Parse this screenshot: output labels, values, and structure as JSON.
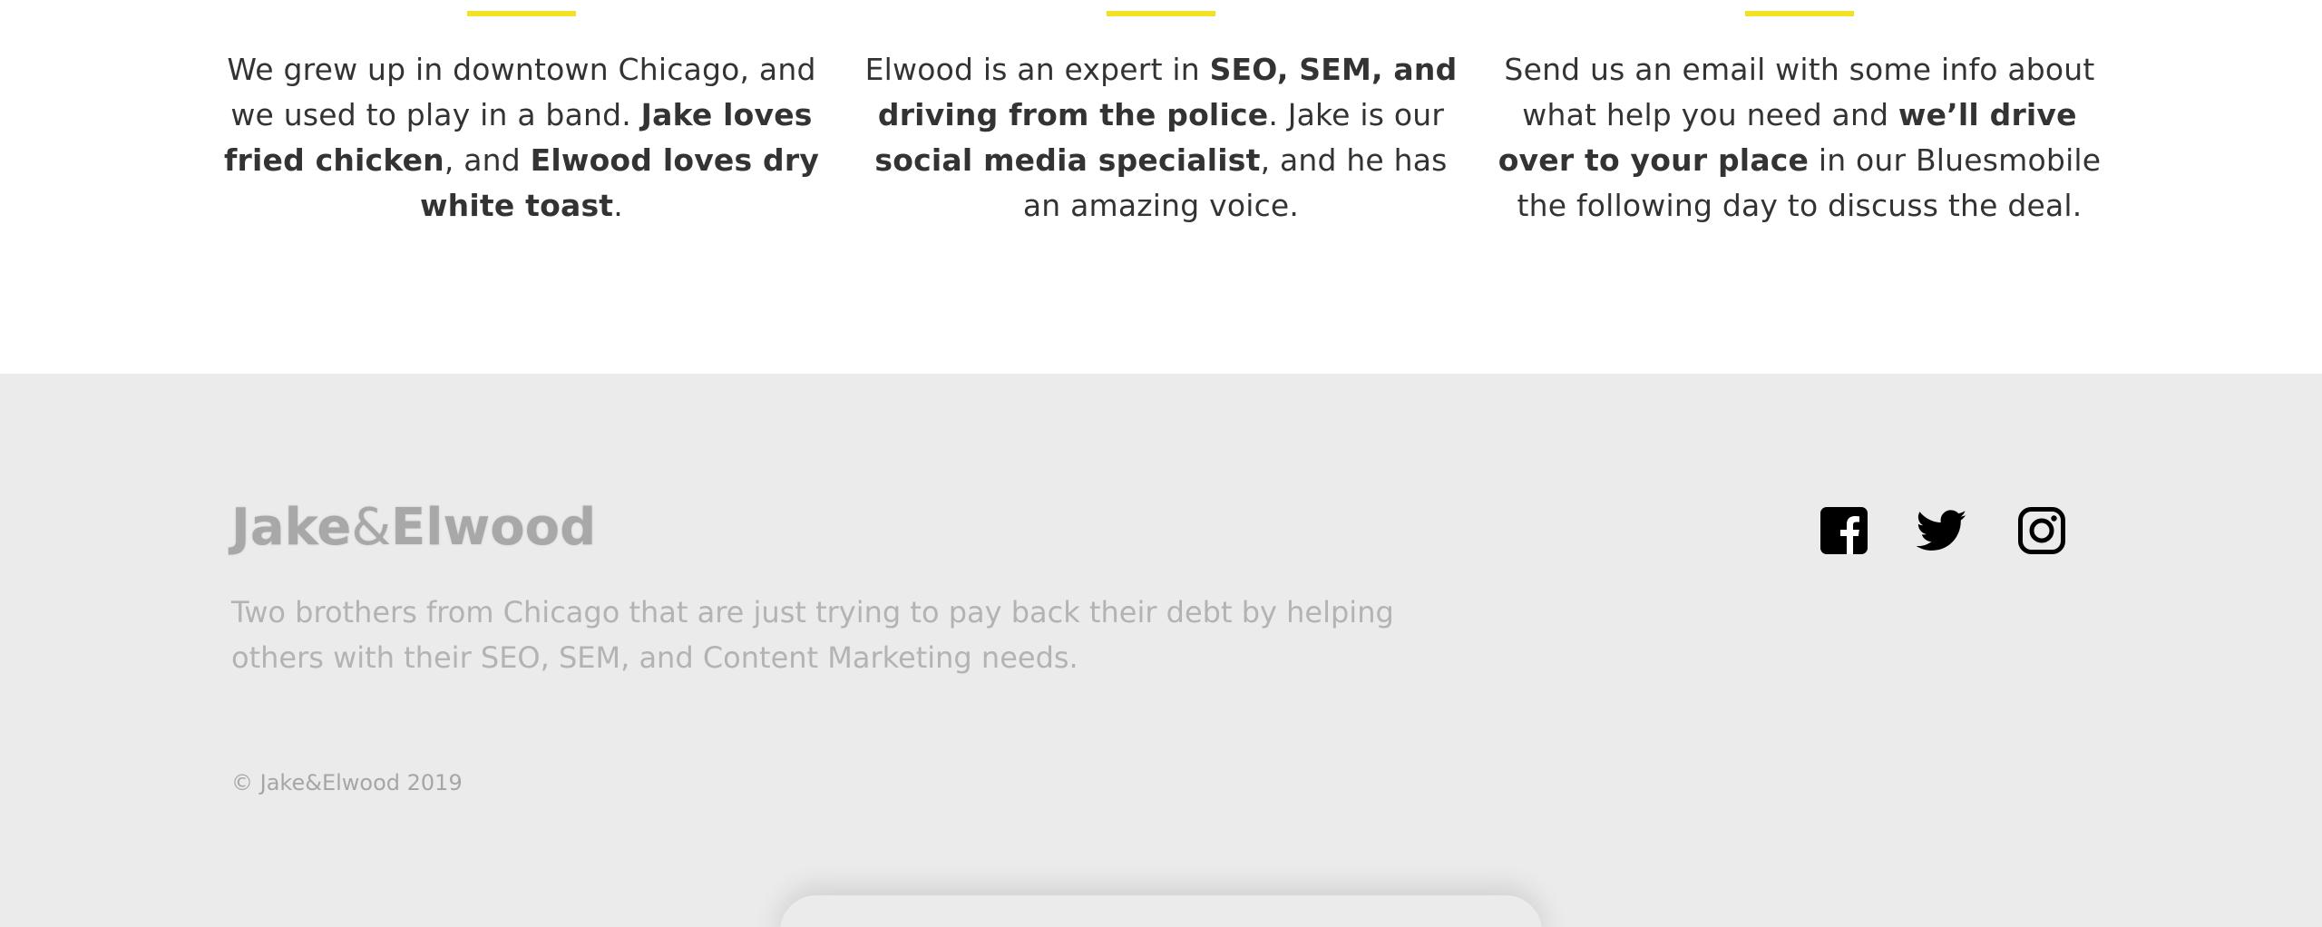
{
  "columns": [
    {
      "parts": [
        {
          "t": "We grew up in downtown Chicago, and we used to play in a band. ",
          "b": false
        },
        {
          "t": "Jake loves fried chicken",
          "b": true
        },
        {
          "t": ", and ",
          "b": false
        },
        {
          "t": "Elwood loves dry white toast",
          "b": true
        },
        {
          "t": ".",
          "b": false
        }
      ]
    },
    {
      "parts": [
        {
          "t": "Elwood is an expert in ",
          "b": false
        },
        {
          "t": "SEO, SEM, and driving from the police",
          "b": true
        },
        {
          "t": ". Jake is our ",
          "b": false
        },
        {
          "t": "social media specialist",
          "b": true
        },
        {
          "t": ", and he has an amazing voice.",
          "b": false
        }
      ]
    },
    {
      "parts": [
        {
          "t": "Send us an email with some info about what help you need and ",
          "b": false
        },
        {
          "t": "we’ll drive over to your place",
          "b": true
        },
        {
          "t": " in our Bluesmobile the following day to discuss the deal.",
          "b": false
        }
      ]
    }
  ],
  "colors": {
    "accent": "#f2e125",
    "footer_bg": "#ebebeb",
    "text": "#333333"
  },
  "footer": {
    "logo_part1": "Jake",
    "logo_amp": "&",
    "logo_part2": "Elwood",
    "description": "Two brothers from Chicago that are just trying to pay back their debt by helping others with their SEO, SEM, and Content Marketing needs.",
    "copyright": "© Jake&Elwood 2019",
    "social": [
      {
        "name": "facebook-icon"
      },
      {
        "name": "twitter-icon"
      },
      {
        "name": "instagram-icon"
      }
    ]
  }
}
